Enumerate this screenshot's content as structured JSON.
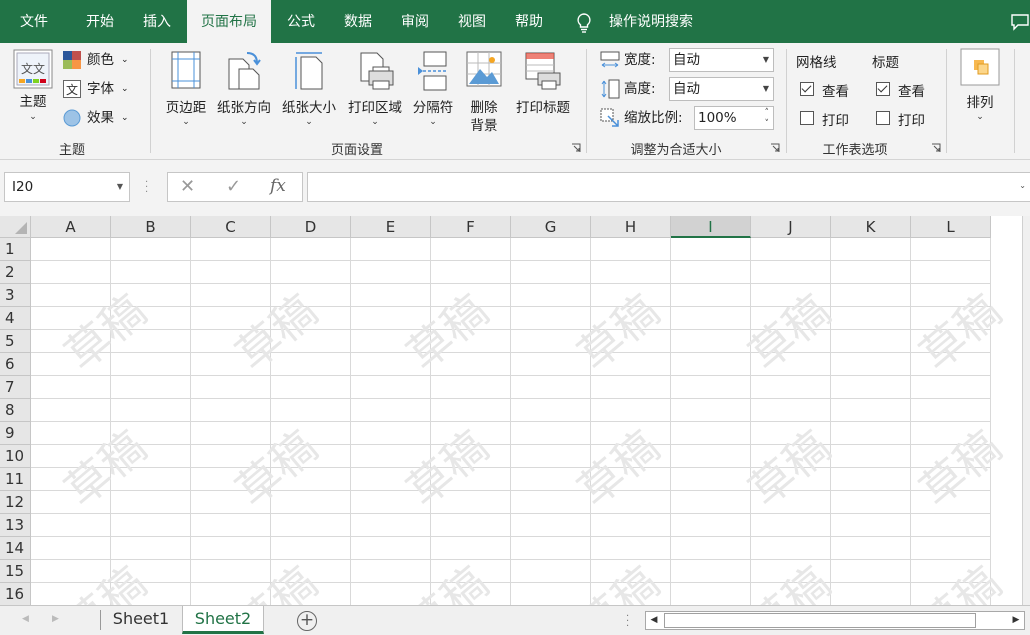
{
  "tabs": [
    {
      "label": "文件"
    },
    {
      "label": "开始"
    },
    {
      "label": "插入"
    },
    {
      "label": "页面布局"
    },
    {
      "label": "公式"
    },
    {
      "label": "数据"
    },
    {
      "label": "审阅"
    },
    {
      "label": "视图"
    },
    {
      "label": "帮助"
    }
  ],
  "active_tab": "页面布局",
  "tell_me": "操作说明搜索",
  "ribbon": {
    "themes": {
      "group_label": "主题",
      "theme_label": "主题",
      "colors_label": "颜色",
      "fonts_label": "字体",
      "effects_label": "效果"
    },
    "page_setup": {
      "group_label": "页面设置",
      "margins": "页边距",
      "orientation": "纸张方向",
      "size": "纸张大小",
      "print_area": "打印区域",
      "breaks": "分隔符",
      "background_line1": "删除",
      "background_line2": "背景",
      "print_titles": "打印标题"
    },
    "scale_to_fit": {
      "group_label": "调整为合适大小",
      "width_label": "宽度:",
      "width_value": "自动",
      "height_label": "高度:",
      "height_value": "自动",
      "scale_label": "缩放比例:",
      "scale_value": "100%"
    },
    "sheet_options": {
      "group_label": "工作表选项",
      "gridlines_label": "网格线",
      "headings_label": "标题",
      "view_label": "查看",
      "print_label": "打印",
      "gridlines_view": true,
      "gridlines_print": false,
      "headings_view": true,
      "headings_print": false
    },
    "arrange": {
      "label": "排列"
    }
  },
  "formula_bar": {
    "name_box": "I20",
    "cancel_symbol": "✕",
    "enter_symbol": "✓",
    "fx_symbol": "fx",
    "formula": ""
  },
  "columns": [
    "A",
    "B",
    "C",
    "D",
    "E",
    "F",
    "G",
    "H",
    "I",
    "J",
    "K",
    "L"
  ],
  "selected_column": "I",
  "rows": [
    "1",
    "2",
    "3",
    "4",
    "5",
    "6",
    "7",
    "8",
    "9",
    "10",
    "11",
    "12",
    "13",
    "14",
    "15",
    "16"
  ],
  "watermark": "草稿",
  "sheets": [
    {
      "name": "Sheet1"
    },
    {
      "name": "Sheet2"
    }
  ],
  "active_sheet": "Sheet2",
  "colors": {
    "accent": "#217346",
    "ribbon_bg": "#f3f3f3",
    "gridline": "#d9d9d9",
    "header_bg": "#e6e6e6"
  }
}
